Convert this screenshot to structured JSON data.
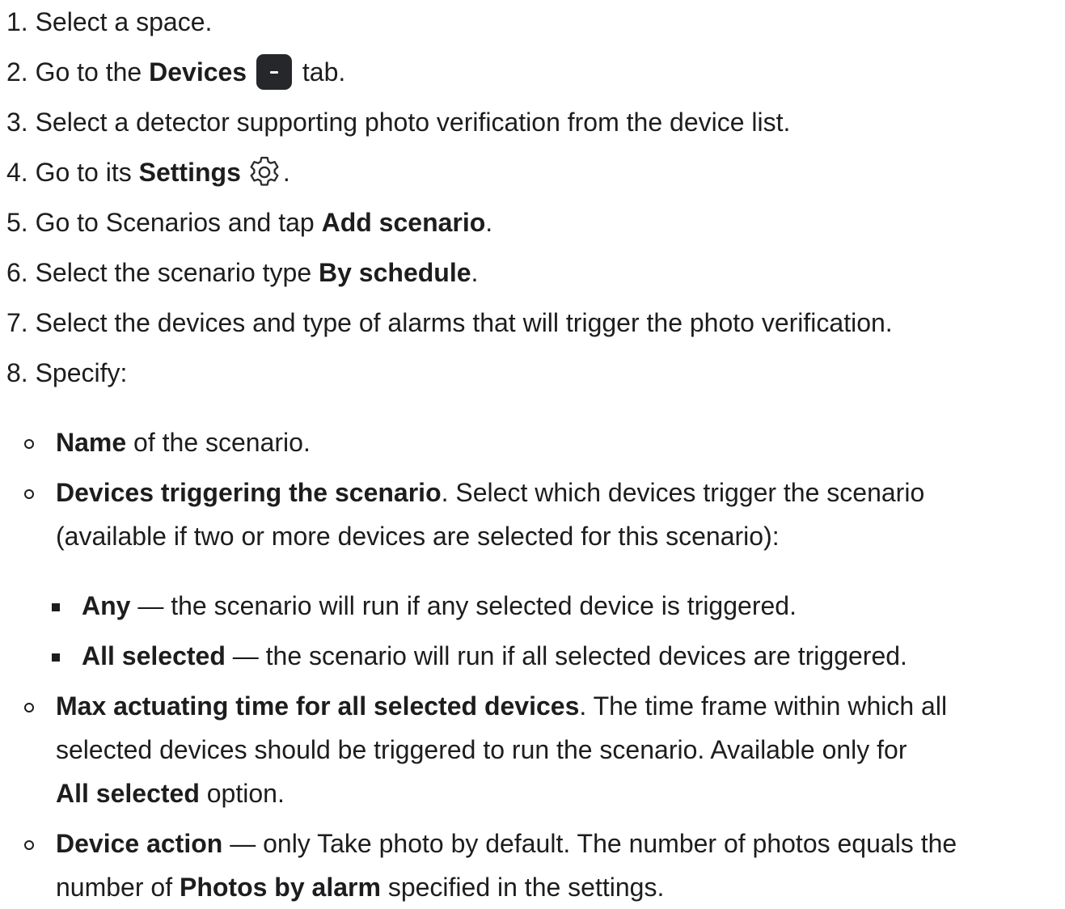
{
  "steps": [
    {
      "num": "1.",
      "text": "Select a space."
    },
    {
      "num": "2.",
      "pre": "Go to the ",
      "bold": "Devices",
      "post": " tab.",
      "icon": "devices-tab-icon"
    },
    {
      "num": "3.",
      "text": "Select a detector supporting photo verification from the device list."
    },
    {
      "num": "4.",
      "pre": "Go to its ",
      "bold": "Settings",
      "post": ".",
      "icon": "gear-icon"
    },
    {
      "num": "5.",
      "pre": "Go to Scenarios and tap ",
      "bold": "Add scenario",
      "post": "."
    },
    {
      "num": "6.",
      "pre": "Select the scenario type ",
      "bold": "By schedule",
      "post": "."
    },
    {
      "num": "7.",
      "text": "Select the devices and type of alarms that will trigger the photo verification."
    },
    {
      "num": "8.",
      "text": "Specify:"
    }
  ],
  "specify": {
    "name": {
      "bold": "Name",
      "text": " of the scenario."
    },
    "devices_triggering": {
      "bold": "Devices triggering the scenario",
      "line1": ". Select which devices trigger the scenario",
      "line2": "(available if two or more devices are selected for this scenario):"
    },
    "options": [
      {
        "bold": "Any",
        "text": " — the scenario will run if any selected device is triggered."
      },
      {
        "bold": "All selected",
        "text": " — the scenario will run if all selected devices are triggered."
      }
    ],
    "max_time": {
      "bold": "Max actuating time for all selected devices",
      "line1": ". The time frame within which all",
      "line2": "selected devices should be triggered to run the scenario. Available only for",
      "bold2": "All selected",
      "line3": " option."
    },
    "device_action": {
      "bold": "Device action",
      "line1": " — only Take photo by default. The number of photos equals the",
      "pre2": "number of ",
      "bold2": "Photos by alarm",
      "post2": " specified in the settings."
    }
  }
}
